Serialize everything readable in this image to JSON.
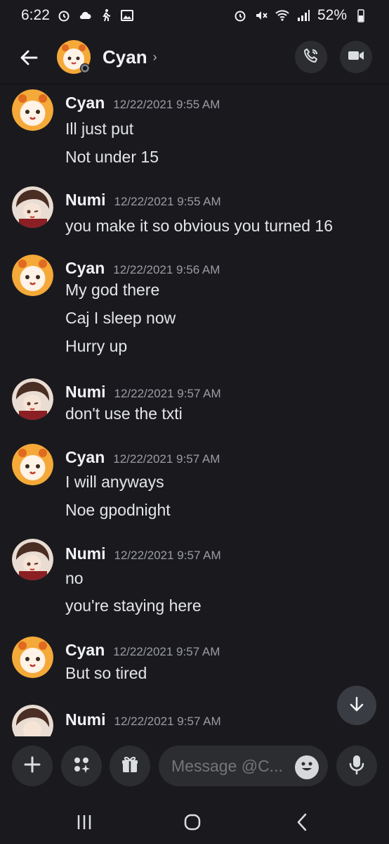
{
  "status_bar": {
    "time": "6:22",
    "battery": "52%",
    "icons_left": [
      "alarm-icon",
      "weather-icon",
      "walking-icon",
      "gallery-icon"
    ],
    "icons_right": [
      "alarm-icon",
      "mute-icon",
      "wifi-icon",
      "signal-icon",
      "battery-icon"
    ]
  },
  "header": {
    "title": "Cyan",
    "chevron": "›",
    "buttons": [
      "call-icon",
      "video-icon"
    ]
  },
  "messages": [
    {
      "author": "Cyan",
      "time": "12/22/2021 9:55 AM",
      "lines": [
        "Ill just put",
        "Not under 15"
      ]
    },
    {
      "author": "Numi",
      "time": "12/22/2021 9:55 AM",
      "lines": [
        "you make it so obvious you turned 16"
      ]
    },
    {
      "author": "Cyan",
      "time": "12/22/2021 9:56 AM",
      "lines": [
        "My god there",
        "Caj I sleep now",
        "Hurry up"
      ]
    },
    {
      "author": "Numi",
      "time": "12/22/2021 9:57 AM",
      "lines": [
        "don't use the txti"
      ]
    },
    {
      "author": "Cyan",
      "time": "12/22/2021 9:57 AM",
      "lines": [
        "I will anyways",
        "Noe gpodnight"
      ]
    },
    {
      "author": "Numi",
      "time": "12/22/2021 9:57 AM",
      "lines": [
        "no",
        "you're staying here"
      ]
    },
    {
      "author": "Cyan",
      "time": "12/22/2021 9:57 AM",
      "lines": [
        "But so tired"
      ]
    },
    {
      "author": "Numi",
      "time": "12/22/2021 9:57 AM",
      "lines": []
    }
  ],
  "composer": {
    "placeholder": "Message @C..."
  },
  "colors": {
    "background": "#1a1a1e",
    "button_bg": "#2b2d31",
    "text_primary": "#f2f3f5",
    "text_muted": "#9a9ca3"
  }
}
